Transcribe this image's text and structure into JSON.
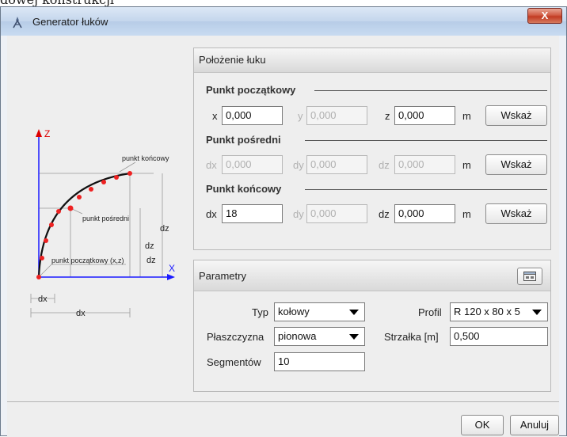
{
  "background_title": "dowej konstrukcji",
  "window": {
    "title": "Generator łuków",
    "close_label": "X"
  },
  "diagram": {
    "axis_z": "Z",
    "axis_x": "X",
    "label_end": "punkt końcowy",
    "label_mid": "punkt pośredni",
    "label_start": "punkt początkowy (x,z)",
    "dz": "dz",
    "dx": "dx"
  },
  "position_panel": {
    "header": "Położenie łuku",
    "start": {
      "title": "Punkt początkowy",
      "x_label": "x",
      "x_value": "0,000",
      "y_label": "y",
      "y_value": "0,000",
      "z_label": "z",
      "z_value": "0,000",
      "unit": "m",
      "button": "Wskaż"
    },
    "mid": {
      "title": "Punkt pośredni",
      "dx_label": "dx",
      "dx_value": "0,000",
      "dy_label": "dy",
      "dy_value": "0,000",
      "dz_label": "dz",
      "dz_value": "0,000",
      "unit": "m",
      "button": "Wskaż"
    },
    "end": {
      "title": "Punkt końcowy",
      "dx_label": "dx",
      "dx_value": "18",
      "dy_label": "dy",
      "dy_value": "0,000",
      "dz_label": "dz",
      "dz_value": "0,000",
      "unit": "m",
      "button": "Wskaż"
    }
  },
  "params_panel": {
    "header": "Parametry",
    "type_label": "Typ",
    "type_value": "kołowy",
    "profile_label": "Profil",
    "profile_value": "R 120 x 80 x 5",
    "plane_label": "Płaszczyzna",
    "plane_value": "pionowa",
    "sag_label": "Strzałka [m]",
    "sag_value": "0,500",
    "segments_label": "Segmentów",
    "segments_value": "10"
  },
  "footer": {
    "ok": "OK",
    "cancel": "Anuluj"
  }
}
